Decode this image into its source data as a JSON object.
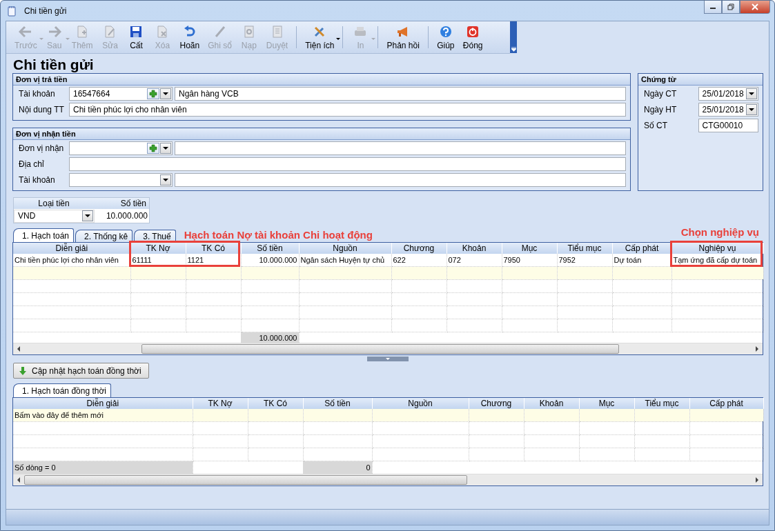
{
  "window": {
    "title": "Chi tiền gửi"
  },
  "toolbar": [
    {
      "label": "Trước",
      "kind": "back",
      "disabled": true,
      "dropdown": true,
      "separator_after": false
    },
    {
      "label": "Sau",
      "kind": "forward",
      "disabled": true,
      "dropdown": true,
      "separator_after": false
    },
    {
      "label": "Thêm",
      "kind": "add",
      "disabled": true,
      "dropdown": false,
      "separator_after": false
    },
    {
      "label": "Sửa",
      "kind": "edit",
      "disabled": true,
      "dropdown": false,
      "separator_after": false
    },
    {
      "label": "Cất",
      "kind": "save",
      "disabled": false,
      "dropdown": false,
      "separator_after": false
    },
    {
      "label": "Xóa",
      "kind": "delete",
      "disabled": true,
      "dropdown": false,
      "separator_after": false
    },
    {
      "label": "Hoãn",
      "kind": "undo",
      "disabled": false,
      "dropdown": false,
      "separator_after": false
    },
    {
      "label": "Ghi sổ",
      "kind": "pencil",
      "disabled": true,
      "dropdown": false,
      "separator_after": false
    },
    {
      "label": "Nạp",
      "kind": "reload",
      "disabled": true,
      "dropdown": false,
      "separator_after": false
    },
    {
      "label": "Duyệt",
      "kind": "list",
      "disabled": true,
      "dropdown": false,
      "separator_after": true
    },
    {
      "label": "Tiện ích",
      "kind": "tools",
      "disabled": false,
      "dropdown": true,
      "separator_after": true
    },
    {
      "label": "In",
      "kind": "print",
      "disabled": true,
      "dropdown": true,
      "separator_after": true
    },
    {
      "label": "Phản hồi",
      "kind": "megaphone",
      "disabled": false,
      "dropdown": false,
      "separator_after": true
    },
    {
      "label": "Giúp",
      "kind": "help",
      "disabled": false,
      "dropdown": false,
      "separator_after": false
    },
    {
      "label": "Đóng",
      "kind": "power",
      "disabled": false,
      "dropdown": false,
      "separator_after": false
    }
  ],
  "heading": "Chi tiền gửi",
  "payer": {
    "title": "Đơn vị trả tiền",
    "account_label": "Tài khoản",
    "account": "16547664",
    "bank": "Ngân hàng VCB",
    "content_label": "Nội dung TT",
    "content": "Chi tiền phúc lợi cho nhân viên"
  },
  "payee": {
    "title": "Đơn vị nhận tiền",
    "unit_label": "Đơn vị nhận",
    "address_label": "Địa chỉ",
    "account_label": "Tài khoản"
  },
  "voucher": {
    "title": "Chứng từ",
    "fields": [
      {
        "label": "Ngày CT",
        "value": "25/01/2018",
        "kind": "date"
      },
      {
        "label": "Ngày HT",
        "value": "25/01/2018",
        "kind": "date"
      },
      {
        "label": "Số CT",
        "value": "CTG00010",
        "kind": "text"
      }
    ]
  },
  "currency": {
    "type_label": "Loại tiền",
    "amount_label": "Số tiền",
    "type": "VND",
    "amount": "10.000.000"
  },
  "tabs": [
    {
      "label": "1. Hạch toán",
      "selected": true
    },
    {
      "label": "2. Thống kê",
      "selected": false
    },
    {
      "label": "3. Thuế",
      "selected": false
    }
  ],
  "annotations": [
    {
      "text": "Hạch toán Nợ tài khoản Chi hoạt động"
    },
    {
      "text": "Chọn nghiệp vụ"
    }
  ],
  "grid": {
    "columns": [
      "Diễn giải",
      "TK Nợ",
      "TK Có",
      "Số tiền",
      "Nguồn",
      "Chương",
      "Khoản",
      "Mục",
      "Tiểu mục",
      "Cấp phát",
      "Nghiệp vụ"
    ],
    "rows": [
      [
        "Chi tiền phúc lợi cho nhân viên",
        "61111",
        "1121",
        "10.000.000",
        "Ngân sách Huyện tự chủ",
        "622",
        "072",
        "7950",
        "7952",
        "Dự toán",
        "Tạm ứng đã cấp dự toán"
      ]
    ],
    "total": "10.000.000"
  },
  "update_button": "Cập nhật hạch toán đồng thời",
  "tabs2": [
    {
      "label": "1. Hạch toán đồng thời",
      "selected": true
    }
  ],
  "grid2": {
    "columns": [
      "Diễn giải",
      "TK Nợ",
      "TK Có",
      "Số tiền",
      "Nguồn",
      "Chương",
      "Khoản",
      "Mục",
      "Tiểu mục",
      "Cấp phát"
    ],
    "new_row_hint": "Bấm vào đây để thêm mới",
    "row_count": "Số dòng = 0",
    "total": "0"
  }
}
